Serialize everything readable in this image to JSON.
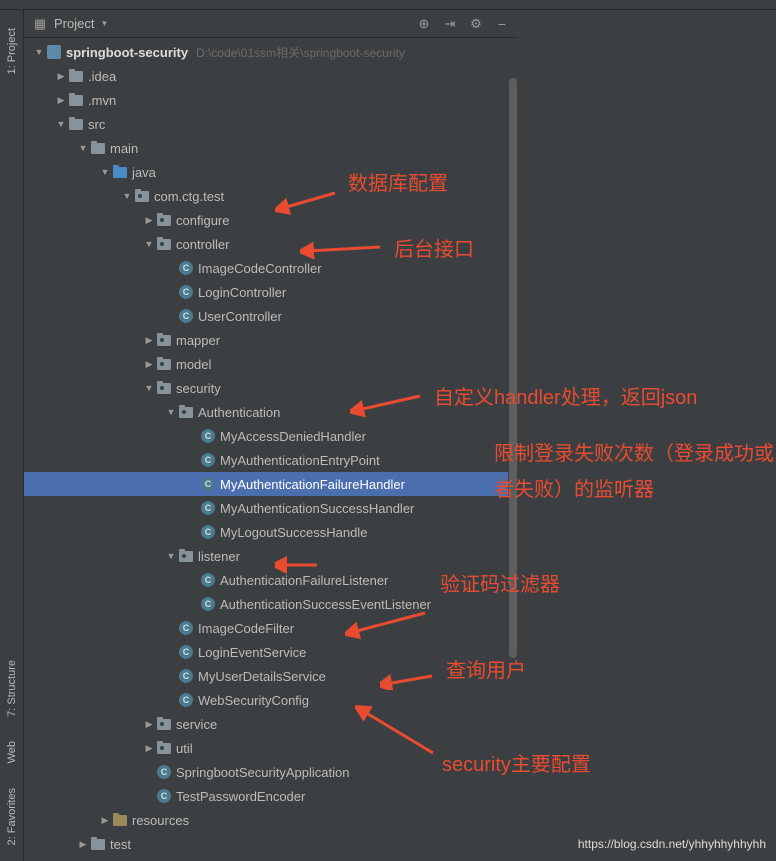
{
  "toolbar": {
    "project_label": "Project",
    "dropdown_icon": "▼"
  },
  "sidebar": {
    "tab_project": "1: Project",
    "tab_structure": "7: Structure",
    "tab_web": "Web",
    "tab_favorites": "2: Favorites"
  },
  "tree": {
    "root": {
      "label": "springboot-security",
      "path": "D:\\code\\01ssm相关\\springboot-security"
    },
    "idea": ".idea",
    "mvn": ".mvn",
    "src": "src",
    "main": "main",
    "java": "java",
    "package": "com.ctg.test",
    "configure": "configure",
    "controller": "controller",
    "imageCodeController": "ImageCodeController",
    "loginController": "LoginController",
    "userController": "UserController",
    "mapper": "mapper",
    "model": "model",
    "security": "security",
    "authentication": "Authentication",
    "myAccessDeniedHandler": "MyAccessDeniedHandler",
    "myAuthenticationEntryPoint": "MyAuthenticationEntryPoint",
    "myAuthenticationFailureHandler": "MyAuthenticationFailureHandler",
    "myAuthenticationSuccessHandler": "MyAuthenticationSuccessHandler",
    "myLogoutSuccessHandle": "MyLogoutSuccessHandle",
    "listener": "listener",
    "authenticationFailureListener": "AuthenticationFailureListener",
    "authenticationSuccessEventListener": "AuthenticationSuccessEventListener",
    "imageCodeFilter": "ImageCodeFilter",
    "loginEventService": "LoginEventService",
    "myUserDetailsService": "MyUserDetailsService",
    "webSecurityConfig": "WebSecurityConfig",
    "service": "service",
    "util": "util",
    "springbootSecurityApplication": "SpringbootSecurityApplication",
    "testPasswordEncoder": "TestPasswordEncoder",
    "resources": "resources",
    "test": "test"
  },
  "annotations": {
    "db_config": "数据库配置",
    "backend_api": "后台接口",
    "custom_handler": "自定义handler处理，返回json",
    "login_fail_limit": "限制登录失败次数（登录成功或者失败）的监听器",
    "captcha_filter": "验证码过滤器",
    "query_user": "查询用户",
    "security_config": "security主要配置"
  },
  "watermark": "https://blog.csdn.net/yhhyhhyhhyhh"
}
